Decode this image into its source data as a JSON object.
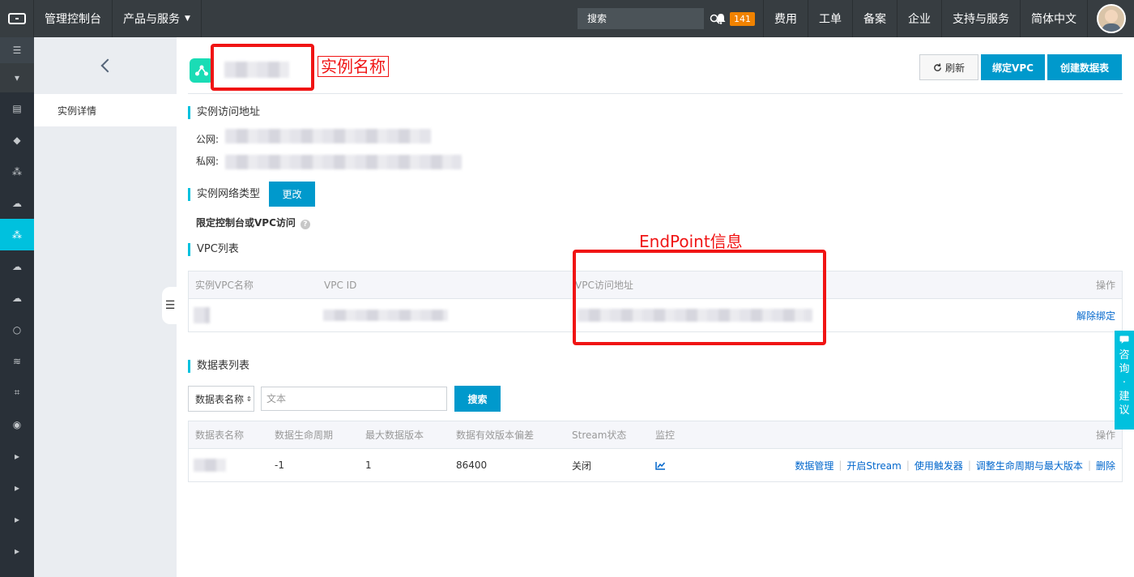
{
  "topbar": {
    "console": "管理控制台",
    "products": "产品与服务",
    "search_placeholder": "搜索",
    "notif_count": "141",
    "items": [
      "费用",
      "工单",
      "备案",
      "企业",
      "支持与服务",
      "简体中文"
    ]
  },
  "sidebar": {
    "sub_item": "实例详情"
  },
  "header": {
    "annotation": "实例名称",
    "refresh": "刷新",
    "bind_vpc": "绑定VPC",
    "create_table": "创建数据表"
  },
  "access": {
    "title": "实例访问地址",
    "public_label": "公网:",
    "private_label": "私网:"
  },
  "network": {
    "title": "实例网络类型",
    "change": "更改",
    "mode": "限定控制台或VPC访问",
    "help": "?"
  },
  "vpc": {
    "title": "VPC列表",
    "annotation": "EndPoint信息",
    "columns": [
      "实例VPC名称",
      "VPC ID",
      "VPC访问地址",
      "操作"
    ],
    "action": "解除绑定"
  },
  "tables": {
    "title": "数据表列表",
    "select_value": "数据表名称",
    "input_placeholder": "文本",
    "search": "搜索",
    "columns": [
      "数据表名称",
      "数据生命周期",
      "最大数据版本",
      "数据有效版本偏差",
      "Stream状态",
      "监控",
      "操作"
    ],
    "row": {
      "ttl": "-1",
      "max_versions": "1",
      "deviation": "86400",
      "stream": "关闭",
      "actions": [
        "数据管理",
        "开启Stream",
        "使用触发器",
        "调整生命周期与最大版本",
        "删除"
      ]
    }
  },
  "consult": [
    "咨",
    "询",
    "·",
    "建",
    "议"
  ],
  "colors": {
    "accent": "#00c1de",
    "primary": "#0099cc",
    "annotation": "#f01414",
    "badge": "#f08200"
  }
}
